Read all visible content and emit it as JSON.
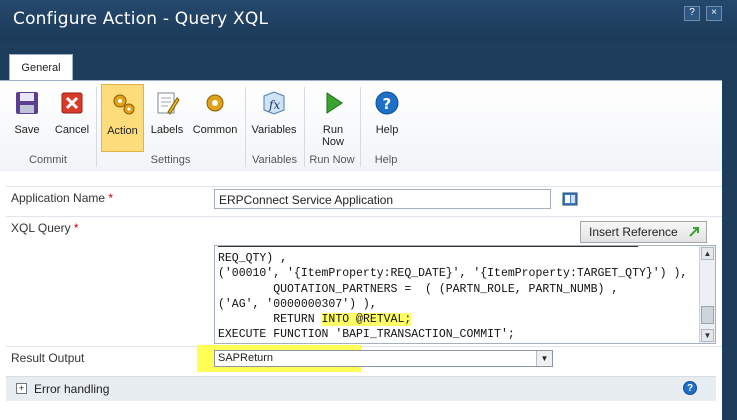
{
  "window": {
    "title": "Configure Action - Query XQL",
    "help_glyph": "?",
    "close_glyph": "×"
  },
  "ribbon": {
    "tab": "General",
    "buttons": [
      {
        "id": "save",
        "label": "Save",
        "icon": "save-disk-icon"
      },
      {
        "id": "cancel",
        "label": "Cancel",
        "icon": "cancel-x-icon"
      },
      {
        "id": "action",
        "label": "Action",
        "icon": "gears-icon"
      },
      {
        "id": "labels",
        "label": "Labels",
        "icon": "labels-edit-icon"
      },
      {
        "id": "common",
        "label": "Common",
        "icon": "gear-icon"
      },
      {
        "id": "variables",
        "label": "Variables",
        "icon": "function-fx-icon"
      },
      {
        "id": "runnow",
        "label": "Run Now",
        "icon": "play-icon"
      },
      {
        "id": "help",
        "label": "Help",
        "icon": "help-icon"
      }
    ],
    "groups": [
      "Commit",
      "Settings",
      "Variables",
      "Run Now",
      "Help"
    ]
  },
  "form": {
    "app_name_label": "Application Name",
    "app_name_value": "ERPConnect Service Application",
    "required_mark": "*",
    "xql_label": "XQL Query",
    "insert_reference": "Insert Reference",
    "code_lines": [
      "REQ_QTY) ,",
      "('00010', '{ItemProperty:REQ_DATE}', '{ItemProperty:TARGET_QTY}') ),",
      "        QUOTATION_PARTNERS =  ( (PARTN_ROLE, PARTN_NUMB) ,",
      "('AG', '0000000307') ),",
      "        RETURN ",
      "INTO @RETVAL;",
      "EXECUTE FUNCTION 'BAPI_TRANSACTION_COMMIT';"
    ],
    "result_output_label": "Result Output",
    "result_output_value": "SAPReturn",
    "error_handling_label": "Error handling"
  },
  "colors": {
    "highlight": "#ffff55",
    "active_button": "#fddc7c",
    "title_bar": "#1e3d5c"
  }
}
